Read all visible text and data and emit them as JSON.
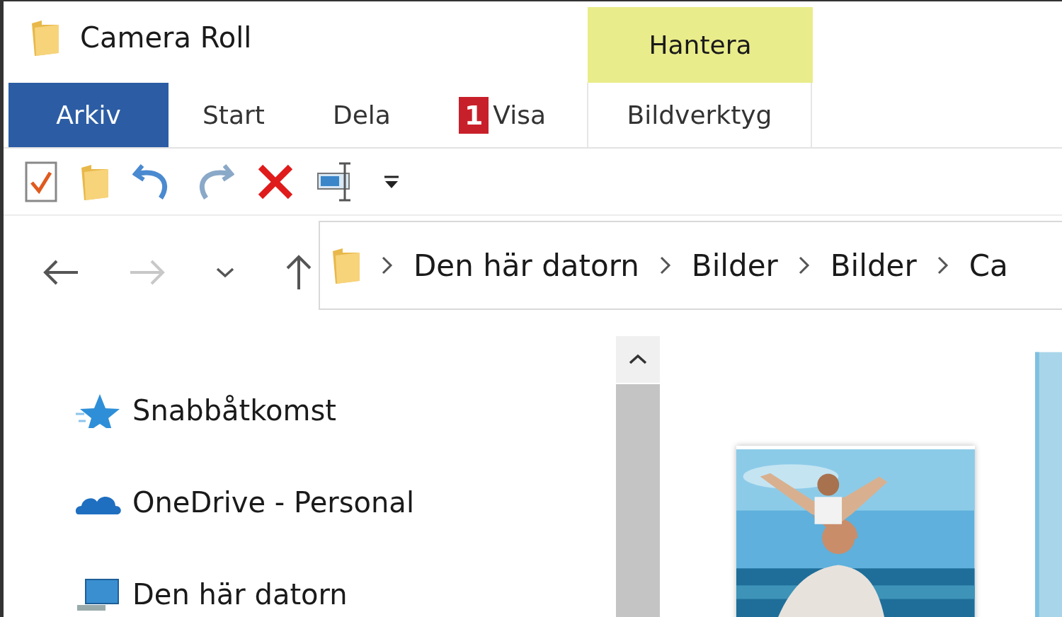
{
  "window": {
    "title": "Camera Roll"
  },
  "contextual_group": {
    "label": "Hantera"
  },
  "ribbon_tabs": [
    {
      "label": "Arkiv",
      "selected": true,
      "kind": "file"
    },
    {
      "label": "Start",
      "selected": false,
      "kind": "normal"
    },
    {
      "label": "Dela",
      "selected": false,
      "kind": "normal"
    },
    {
      "label": "Visa",
      "selected": false,
      "kind": "normal",
      "badge": "1"
    },
    {
      "label": "Bildverktyg",
      "selected": false,
      "kind": "contextual"
    }
  ],
  "nav_buttons": [
    {
      "kind": "back",
      "disabled": false
    },
    {
      "kind": "forward",
      "disabled": true
    },
    {
      "kind": "recent",
      "disabled": false
    },
    {
      "kind": "up",
      "disabled": false
    }
  ],
  "address_bar": {
    "segments": [
      "Den här datorn",
      "Bilder",
      "Bilder",
      "Ca"
    ]
  },
  "nav_pane": {
    "items": [
      {
        "label": "Snabbåtkomst",
        "kind": "quick-access"
      },
      {
        "label": "OneDrive - Personal",
        "kind": "onedrive"
      },
      {
        "label": "Den här datorn",
        "kind": "computer"
      }
    ]
  }
}
